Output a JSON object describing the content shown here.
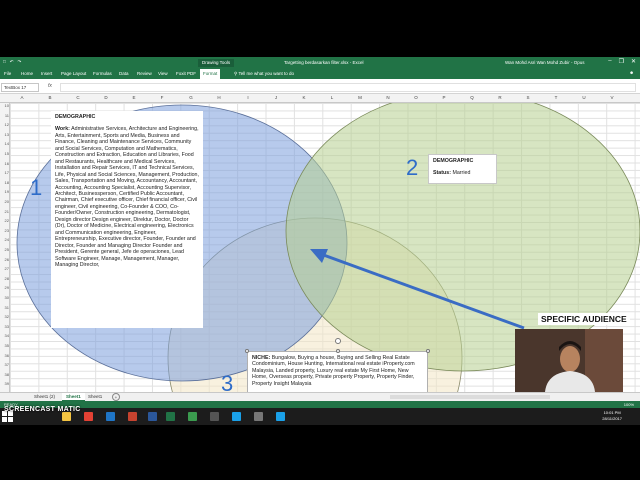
{
  "window": {
    "title": "Targetting berdasarkan filter.xlsx  -  Excel",
    "drawing_tools": "Drawing Tools",
    "user": "Wan Mohd Asri Wan Mohd Zubir",
    "opus": "Opus",
    "undo_icon": "undo-icon",
    "redo_icon": "redo-icon"
  },
  "ribbon": {
    "tabs": [
      "File",
      "Home",
      "Insert",
      "Page Layout",
      "Formulas",
      "Data",
      "Review",
      "View",
      "Foxit PDF",
      "Format"
    ],
    "tell_me": "Tell me what you want to do",
    "share": "Share"
  },
  "formula_bar": {
    "name_box": "TextBox 17",
    "fx": "fx",
    "value": ""
  },
  "columns": [
    "A",
    "B",
    "C",
    "D",
    "E",
    "F",
    "G",
    "H",
    "I",
    "J",
    "K",
    "L",
    "M",
    "N",
    "O",
    "P",
    "Q",
    "R",
    "S",
    "T",
    "U",
    "V"
  ],
  "rows": [
    "10",
    "11",
    "12",
    "13",
    "14",
    "15",
    "16",
    "17",
    "18",
    "19",
    "20",
    "21",
    "22",
    "23",
    "24",
    "25",
    "26",
    "27",
    "28",
    "29",
    "30",
    "31",
    "32",
    "33",
    "34",
    "35",
    "36",
    "37",
    "38",
    "39"
  ],
  "venn": {
    "circle1_number": "1",
    "circle2_number": "2",
    "circle3_number": "3",
    "circle1_color": "#7b9fdc",
    "circle2_color": "#b7d08f",
    "circle3_color": "#f2e6c4",
    "arrow_color": "#3a6cc4"
  },
  "demographic1": {
    "heading": "DEMOGRAPHIC",
    "work_label": "Work:",
    "work_text": "Administrative Services, Architecture and Engineering, Arts, Entertainment, Sports and Media, Business and Finance, Cleaning and Maintenance Services, Community and Social Services, Computation and Mathematics, Construction and Extraction, Education and Libraries, Food and Restaurants, Healthcare and Medical Services, Installation and Repair Services, IT and Technical Services, Life, Physical and Social Sciences, Management, Production, Sales, Transportation and Moving, Accountancy, Accountant, Accounting, Accounting Specialist, Accounting Supervisor, Architect, Businessperson, Certified Public Accountant, Chairman, Chief executive officer, Chief financial officer, Civil engineer, Civil engineering, Co-Founder & COO, Co-Founder/Owner, Construction engineering, Dermatologist, Design director Design engineer, Direktur, Doctor, Doctor (Dr), Doctor of Medicine, Electrical engineering, Electronics and Communication engineering, Engineer, Entrepreneurship, Executive director, Founder, Founder and Director, Founder and Managing Director Founder and President, Gerente general, Jefe de operaciones, Lead Software Engineer, Manage, Management, Manager, Managing Director,"
  },
  "demographic2": {
    "heading": "DEMOGRAPHIC",
    "status_label": "Status:",
    "status_value": "Married"
  },
  "niche": {
    "label": "NICHE:",
    "text": "Bungalow, Buying a house, Buying and Selling Real Estate Condominium, House Hunting, International real estate iProperty.com Malaysia, Landed property, Luxury real estate My First Home, New Home, Overseas property, Private property Property, Property Finder, Property Insight Malaysia"
  },
  "specific_audience": "SPECIFIC AUDIENCE",
  "sheet_tabs": [
    "Sheet1 (2)",
    "Sheet1",
    "Sheet1"
  ],
  "active_sheet_index": 1,
  "status": {
    "ready": "READY",
    "zoom": "100%"
  },
  "taskbar": {
    "watermark": "SCREENCAST  MATIC",
    "time": "10:01 PM",
    "date": "28/11/2017"
  }
}
